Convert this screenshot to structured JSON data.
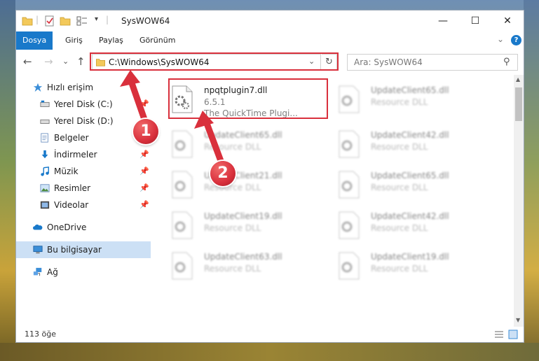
{
  "window": {
    "title": "SysWOW64",
    "minimize": "—",
    "maximize": "☐",
    "close": "✕"
  },
  "ribbon": {
    "tabs": [
      "Dosya",
      "Giriş",
      "Paylaş",
      "Görünüm"
    ],
    "expand": "⌄",
    "help": "?"
  },
  "nav": {
    "back": "←",
    "forward": "→",
    "recent": "⌄",
    "up": "↑",
    "address": "C:\\Windows\\SysWOW64",
    "address_dropdown": "⌄",
    "refresh": "↻",
    "search_placeholder": "Ara: SysWOW64",
    "search_icon": "⚲"
  },
  "sidebar": {
    "items": [
      {
        "label": "Hızlı erişim",
        "icon": "star-icon",
        "pin": ""
      },
      {
        "label": "Yerel Disk (C:)",
        "icon": "drive-icon",
        "pin": "📌"
      },
      {
        "label": "Yerel Disk (D:)",
        "icon": "drive-icon",
        "pin": ""
      },
      {
        "label": "Belgeler",
        "icon": "documents-icon",
        "pin": ""
      },
      {
        "label": "İndirmeler",
        "icon": "download-icon",
        "pin": "📌"
      },
      {
        "label": "Müzik",
        "icon": "music-icon",
        "pin": "📌"
      },
      {
        "label": "Resimler",
        "icon": "pictures-icon",
        "pin": "📌"
      },
      {
        "label": "Videolar",
        "icon": "videos-icon",
        "pin": "📌"
      },
      {
        "label": "OneDrive",
        "icon": "cloud-icon",
        "pin": ""
      },
      {
        "label": "Bu bilgisayar",
        "icon": "computer-icon",
        "pin": ""
      },
      {
        "label": "Ağ",
        "icon": "network-icon",
        "pin": ""
      }
    ]
  },
  "files": [
    {
      "name": "npqtplugin7.dll",
      "line1": "6.5.1",
      "line2": "The QuickTime Plugi..."
    },
    {
      "name": "UpdateClient65.dll",
      "line1": "Resource DLL",
      "line2": ""
    },
    {
      "name": "UpdateClient65.dll",
      "line1": "Resource DLL",
      "line2": ""
    },
    {
      "name": "UpdateClient42.dll",
      "line1": "Resource DLL",
      "line2": ""
    },
    {
      "name": "UpdateClient21.dll",
      "line1": "Resource DLL",
      "line2": ""
    },
    {
      "name": "UpdateClient65.dll",
      "line1": "Resource DLL",
      "line2": ""
    },
    {
      "name": "UpdateClient19.dll",
      "line1": "Resource DLL",
      "line2": ""
    },
    {
      "name": "UpdateClient42.dll",
      "line1": "Resource DLL",
      "line2": ""
    },
    {
      "name": "UpdateClient63.dll",
      "line1": "Resource DLL",
      "line2": ""
    },
    {
      "name": "UpdateClient19.dll",
      "line1": "Resource DLL",
      "line2": ""
    }
  ],
  "status": {
    "count": "113 öğe"
  },
  "annotations": {
    "step1": "1",
    "step2": "2"
  },
  "colors": {
    "accent": "#1979ca",
    "highlight": "#d9303c",
    "selection": "#cce0f5"
  }
}
